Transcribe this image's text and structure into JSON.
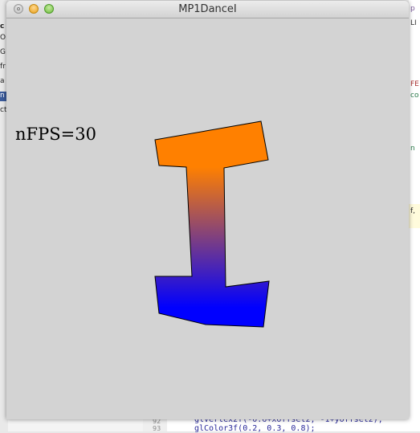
{
  "window": {
    "title": "MP1DanceI"
  },
  "canvas": {
    "fps_label": "nFPS=30",
    "background_color": "#d3d3d3"
  },
  "shape": {
    "top_color": "#ff8000",
    "bottom_color": "#0000ff"
  },
  "background_editor": {
    "left_fragments": [
      "c",
      "O",
      "G",
      "fr",
      "a",
      "n",
      "ct"
    ],
    "right_fragments": [
      "p",
      "LI",
      "FE",
      "co",
      "n",
      "f,"
    ],
    "line_numbers": [
      "92",
      "93"
    ],
    "code_lines": [
      "glVertex2f(-0.6+xOffset2, -1+yOffset2);",
      "glColor3f(0.2, 0.3, 0.8);"
    ]
  }
}
